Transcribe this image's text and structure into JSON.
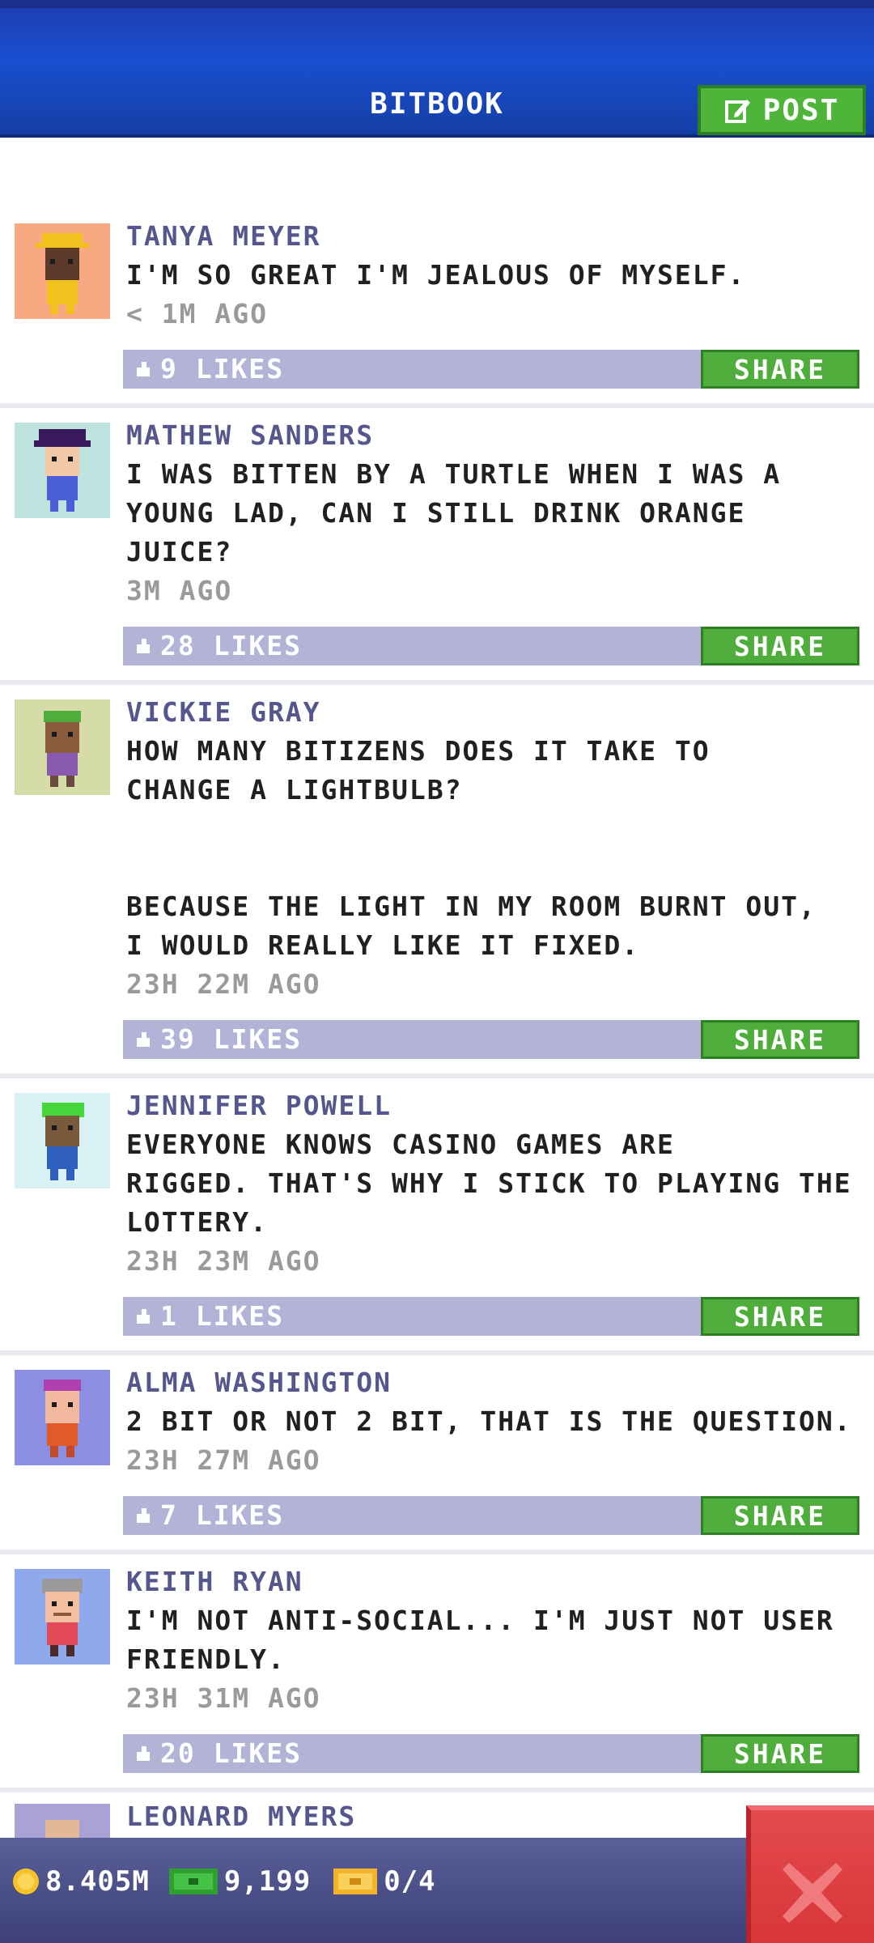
{
  "header": {
    "title": "BITBOOK",
    "post_label": "POST",
    "post_icon": "edit-icon"
  },
  "posts": [
    {
      "author": "TANYA MEYER",
      "text": "I'M SO GREAT I'M JEALOUS OF MYSELF.",
      "time": "< 1M AGO",
      "likes": "9 LIKES",
      "share": "SHARE",
      "avatar_bg": "#f9a982"
    },
    {
      "author": "MATHEW SANDERS",
      "text": "I WAS BITTEN BY A TURTLE WHEN I WAS A\nYOUNG LAD, CAN I STILL DRINK ORANGE\nJUICE?",
      "time": "3M AGO",
      "likes": "28 LIKES",
      "share": "SHARE",
      "avatar_bg": "#bde4df"
    },
    {
      "author": "VICKIE GRAY",
      "text": "HOW MANY BITIZENS DOES IT TAKE TO\nCHANGE A LIGHTBULB?\n\n\nBECAUSE THE LIGHT IN MY ROOM BURNT OUT,\nI WOULD REALLY LIKE IT FIXED.",
      "time": "23H 22M AGO",
      "likes": "39 LIKES",
      "share": "SHARE",
      "avatar_bg": "#d6dca8"
    },
    {
      "author": "JENNIFER POWELL",
      "text": "EVERYONE KNOWS CASINO GAMES ARE\nRIGGED. THAT'S WHY I STICK TO PLAYING THE\nLOTTERY.",
      "time": "23H 23M AGO",
      "likes": "1 LIKES",
      "share": "SHARE",
      "avatar_bg": "#d8f2f6"
    },
    {
      "author": "ALMA WASHINGTON",
      "text": "2 BIT OR NOT 2 BIT, THAT IS THE QUESTION.",
      "time": "23H 27M AGO",
      "likes": "7 LIKES",
      "share": "SHARE",
      "avatar_bg": "#8c8ee2"
    },
    {
      "author": "KEITH RYAN",
      "text": "I'M NOT ANTI-SOCIAL... I'M JUST NOT USER\nFRIENDLY.",
      "time": "23H 31M AGO",
      "likes": "20 LIKES",
      "share": "SHARE",
      "avatar_bg": "#90a8ec"
    },
    {
      "author": "LEONARD MYERS",
      "avatar_bg": "#a9a2d4"
    }
  ],
  "footer": {
    "coins": "8.405M",
    "cash": "9,199",
    "tickets": "0/4",
    "close_icon": "close-icon"
  },
  "colors": {
    "header_blue": "#1a4fd0",
    "share_green": "#4fae3b",
    "like_bar": "#b3b3d8",
    "author_purple": "#56568e",
    "close_red": "#d8363a"
  }
}
